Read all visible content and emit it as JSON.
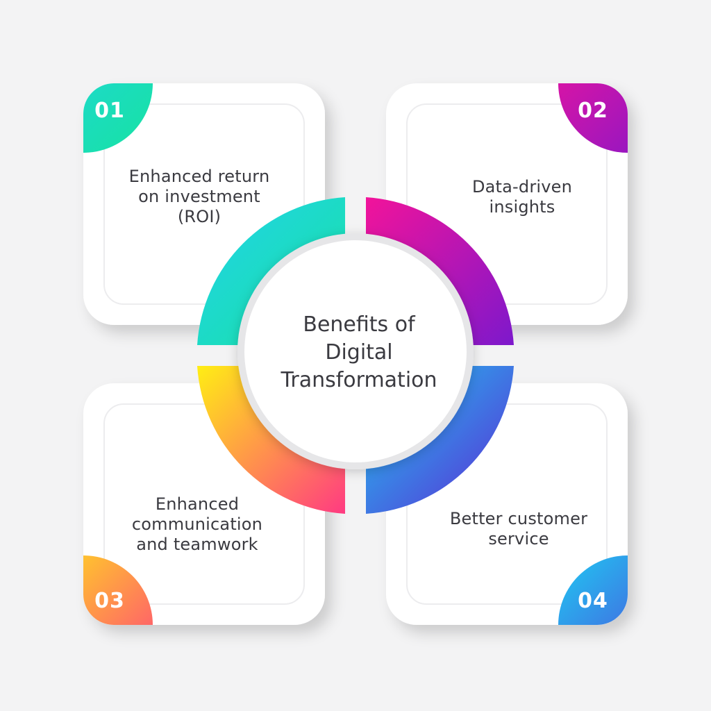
{
  "center": {
    "title": "Benefits of\nDigital\nTransformation"
  },
  "benefits": [
    {
      "number": "01",
      "text": "Enhanced return\non investment\n(ROI)",
      "gradient": [
        "#21d4e8",
        "#19e0a6"
      ]
    },
    {
      "number": "02",
      "text": "Data-driven\ninsights",
      "gradient": [
        "#f0139b",
        "#8a16c9"
      ]
    },
    {
      "number": "03",
      "text": "Enhanced\ncommunication\nand teamwork",
      "gradient": [
        "#ffe81a",
        "#ff3d7f"
      ]
    },
    {
      "number": "04",
      "text": "Better customer\nservice",
      "gradient": [
        "#1cc7f2",
        "#5b2bd6"
      ]
    }
  ],
  "colors": {
    "background": "#f3f3f4",
    "card": "#ffffff",
    "text": "#3a3a40"
  }
}
